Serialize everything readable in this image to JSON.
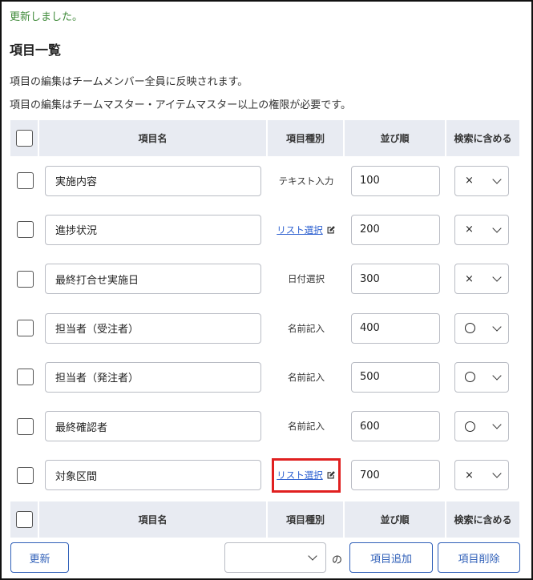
{
  "flash_message": "更新しました。",
  "page_title": "項目一覧",
  "descriptions": [
    "項目の編集はチームメンバー全員に反映されます。",
    "項目の編集はチームマスター・アイテムマスター以上の権限が必要です。"
  ],
  "table": {
    "headers": {
      "name": "項目名",
      "type": "項目種別",
      "order": "並び順",
      "search": "検索に含める"
    },
    "rows": [
      {
        "name": "実施内容",
        "type": "テキスト入力",
        "type_is_link": false,
        "order": "100",
        "search": "×"
      },
      {
        "name": "進捗状況",
        "type": "リスト選択",
        "type_is_link": true,
        "order": "200",
        "search": "×"
      },
      {
        "name": "最終打合せ実施日",
        "type": "日付選択",
        "type_is_link": false,
        "order": "300",
        "search": "×"
      },
      {
        "name": "担当者（受注者）",
        "type": "名前記入",
        "type_is_link": false,
        "order": "400",
        "search": "○"
      },
      {
        "name": "担当者（発注者）",
        "type": "名前記入",
        "type_is_link": false,
        "order": "500",
        "search": "○"
      },
      {
        "name": "最終確認者",
        "type": "名前記入",
        "type_is_link": false,
        "order": "600",
        "search": "○"
      },
      {
        "name": "対象区間",
        "type": "リスト選択",
        "type_is_link": true,
        "order": "700",
        "search": "×",
        "highlighted": true
      }
    ]
  },
  "footer": {
    "update_button": "更新",
    "position_select_value": "",
    "no_label": "の",
    "add_button": "項目追加",
    "delete_button": "項目削除"
  },
  "colors": {
    "flash": "#3f8a3a",
    "link": "#2b5fd0",
    "button_border": "#2f5fb8",
    "header_bg": "#e8ebf2",
    "highlight": "#e02020"
  },
  "icons": {
    "edit": "edit-icon",
    "chevron": "chevron-down-icon",
    "circle": "circle-icon"
  }
}
